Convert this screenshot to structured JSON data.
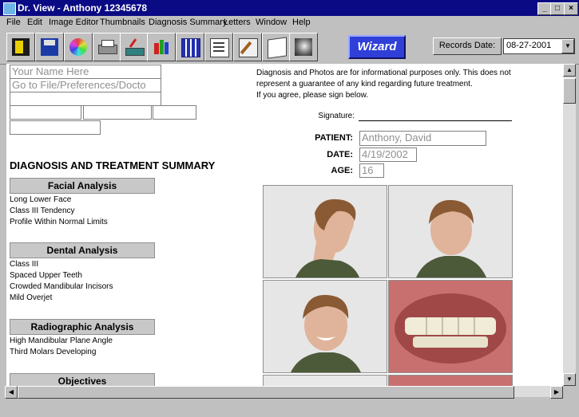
{
  "window": {
    "title": "Dr. View - Anthony  12345678"
  },
  "menu": [
    "File",
    "Edit",
    "Image Editor",
    "Thumbnails",
    "Diagnosis Summary",
    "Letters",
    "Window",
    "Help"
  ],
  "toolbar": {
    "wizard_label": "Wizard",
    "records_date_label": "Records Date:",
    "records_date_value": "08-27-2001"
  },
  "header_fields": {
    "name_placeholder": "Your Name Here",
    "address_placeholder": "Go to File/Preferences/Docto"
  },
  "summary_heading": "DIAGNOSIS AND TREATMENT SUMMARY",
  "sections": [
    {
      "title": "Facial Analysis",
      "items": [
        "Long Lower Face",
        "Class III Tendency",
        "Profile Within Normal Limits"
      ]
    },
    {
      "title": "Dental Analysis",
      "items": [
        "Class III",
        "Spaced Upper Teeth",
        "Crowded Mandibular Incisors",
        "Mild Overjet"
      ]
    },
    {
      "title": "Radiographic Analysis",
      "items": [
        "High Mandibular Plane Angle",
        "Third Molars Developing"
      ]
    },
    {
      "title": "Objectives",
      "items": []
    }
  ],
  "disclaimer": [
    "Diagnosis and Photos are for informational purposes only.  This does not",
    "represent a guarantee of any kind regarding future treatment.",
    "If you agree, please sign below."
  ],
  "signature_label": "Signature:",
  "patient": {
    "patient_label": "PATIENT:",
    "patient_value": "Anthony, David",
    "date_label": "DATE:",
    "date_value": "4/19/2002",
    "age_label": "AGE:",
    "age_value": "16"
  },
  "colors": {
    "titlebar": "#0a0a84",
    "wizard": "#2f3fd8",
    "window_bg": "#c0c0c0"
  }
}
